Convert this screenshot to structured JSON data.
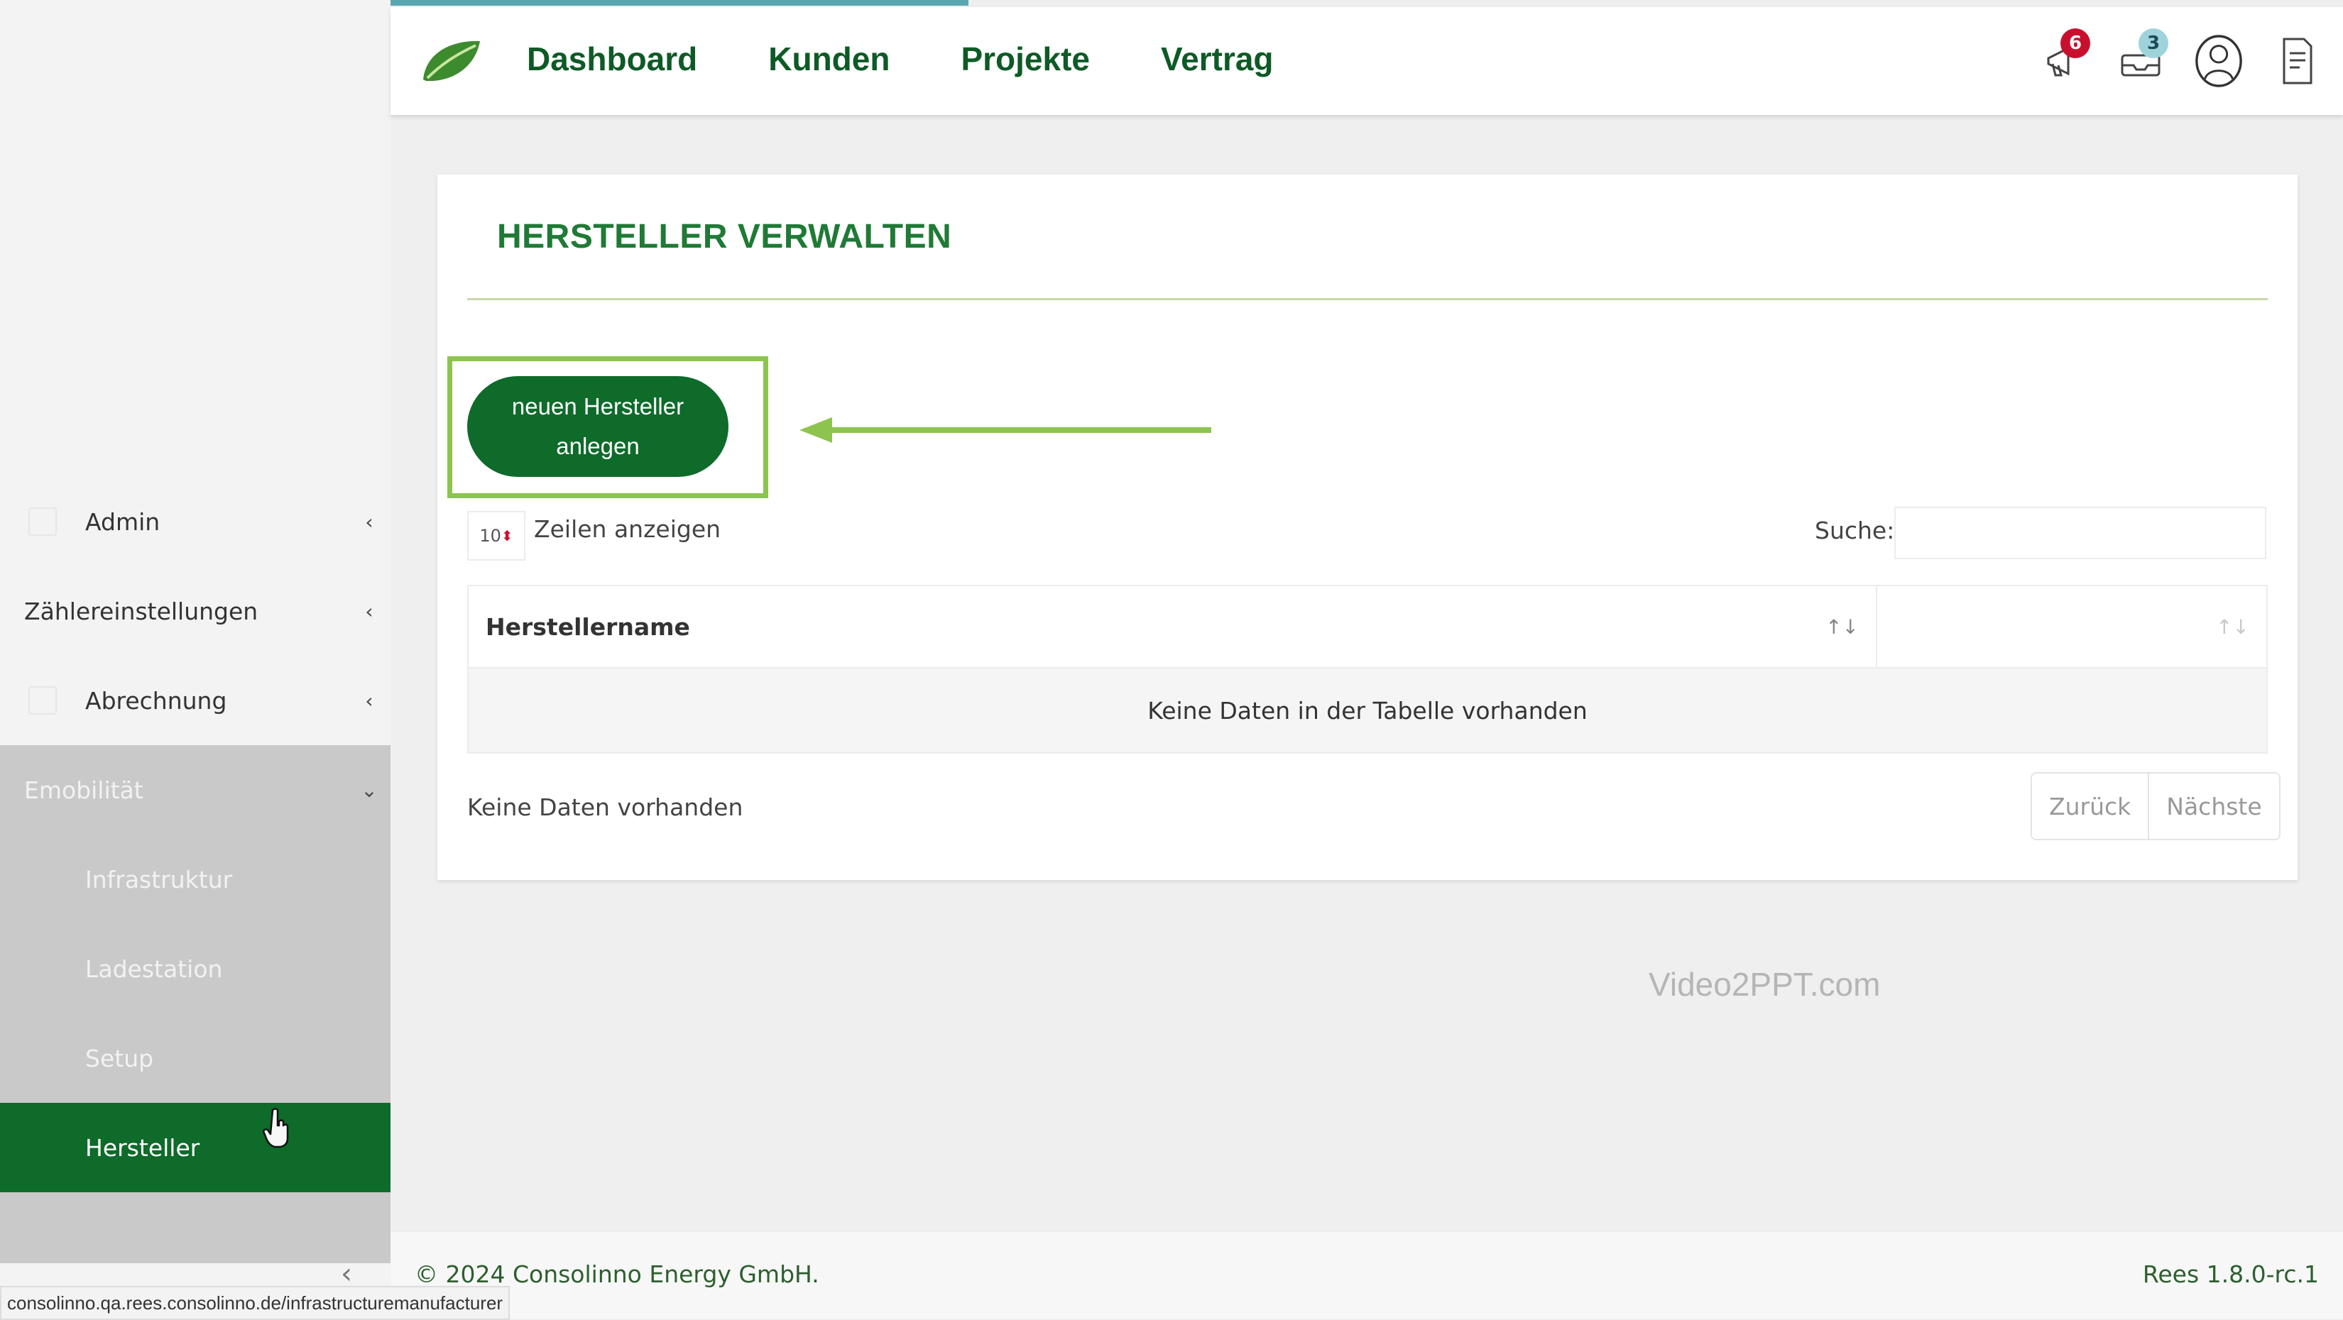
{
  "nav": {
    "items": [
      "Dashboard",
      "Kunden",
      "Projekte",
      "Vertrag"
    ]
  },
  "top_icons": {
    "notifications": {
      "icon": "megaphone-icon",
      "count": "6"
    },
    "messages": {
      "icon": "inbox-icon",
      "count": "3"
    },
    "user": {
      "icon": "user-icon"
    },
    "documents": {
      "icon": "document-icon"
    }
  },
  "sidebar": {
    "admin": "Admin",
    "zaehler": "Zählereinstellungen",
    "abrechnung": "Abrechnung",
    "emobilitaet": "Emobilität",
    "infrastruktur": "Infrastruktur",
    "ladestation": "Ladestation",
    "setup": "Setup",
    "hersteller": "Hersteller"
  },
  "page": {
    "title": "HERSTELLER VERWALTEN",
    "new_button_line1": "neuen Hersteller",
    "new_button_line2": "anlegen",
    "page_length": "10",
    "page_length_label": "Zeilen anzeigen",
    "search_label": "Suche:",
    "search_value": ""
  },
  "table": {
    "columns": [
      "Herstellername",
      ""
    ],
    "empty_text": "Keine Daten in der Tabelle vorhanden"
  },
  "pagination": {
    "info": "Keine Daten vorhanden",
    "prev": "Zurück",
    "next": "Nächste"
  },
  "watermark": "Video2PPT.com",
  "footer": {
    "copyright": "© 2024 Consolinno Energy GmbH.",
    "version": "Rees 1.8.0-rc.1"
  },
  "status_url": "consolinno.qa.rees.consolinno.de/infrastructuremanufacturer",
  "colors": {
    "brand_green": "#0e6b2a",
    "highlight_green": "#8cc44e",
    "badge_red": "#c8102e"
  }
}
